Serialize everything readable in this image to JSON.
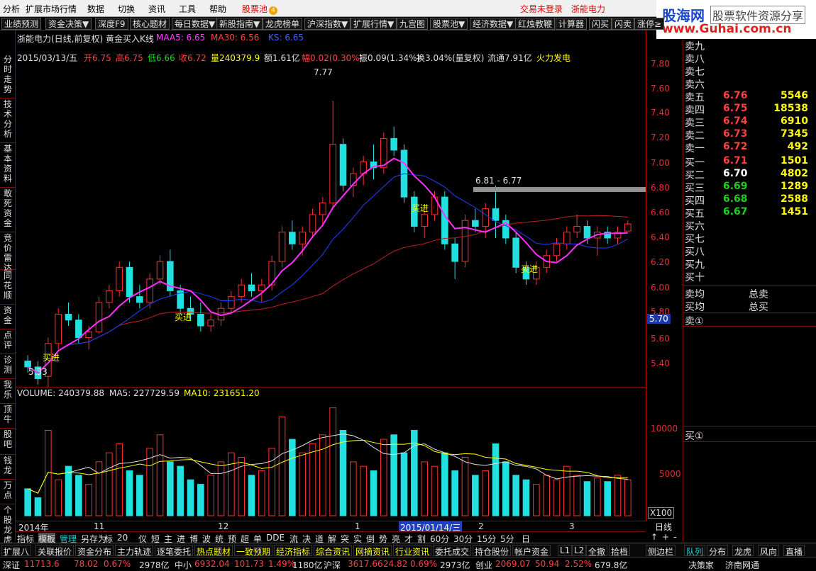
{
  "menu": {
    "items": [
      "分析",
      "扩展市场行情",
      "数据",
      "切换",
      "资讯",
      "工具",
      "帮助"
    ],
    "pool_label": "股票池",
    "pool_badge": "4",
    "login_status": "交易未登录",
    "stock_name": "浙能电力"
  },
  "logo": {
    "brand": "股海网",
    "tagline": "股票软件资源分享",
    "url": "www.Guhai.com.cn"
  },
  "toolbar": [
    "业绩预测",
    "资金决策▼",
    "深度F9",
    "核心题材",
    "每日数据▼",
    "新股指南▼",
    "龙虎榜单",
    "沪深指数▼",
    "扩展行情▼",
    "九宫图",
    "股票池▼",
    "经济数据▼",
    "红烛教鞭",
    "计算器",
    "闪买",
    "闪卖",
    "涨停≥"
  ],
  "left_tabs": [
    "分时走势",
    "技术分析",
    "基本资料",
    "敢死资金",
    "竞价雷达",
    "同花顺",
    "资金",
    "点评",
    "诊测",
    "我乐",
    "顶牛",
    "股吧",
    "钱龙",
    "万点",
    "个股龙虎"
  ],
  "chart": {
    "title": "浙能电力(日线,前复权) 黄金买入K线",
    "ma5_label": "MAA5: 6.65",
    "ma30_label": "MA30: 6.56",
    "ks_label": "KS: 6.65",
    "date": "2015/03/13/五",
    "open": "开6.75",
    "high": "高6.75",
    "low": "低6.66",
    "close": "收6.72",
    "volume_info": "量240379.9",
    "amount": "额1.61亿",
    "change": "幅0.02(0.30%)",
    "amplitude": "振0.09(1.34%)",
    "turnover": "换3.04%(量复权)",
    "float": "流通7.91亿",
    "sector": "火力发电",
    "high_mark": "7.77",
    "low_mark": "5.33",
    "range_label": "6.81 - 6.77",
    "buy_label": "买进",
    "current_price": "5.70",
    "vol_title": "VOLUME: 240379.88",
    "vol_ma5": "MA5: 227729.59",
    "vol_ma10": "MA10: 231651.20",
    "x_labels": [
      "2014年",
      "11",
      "12",
      "1",
      "2015/01/14/三",
      "2",
      "3"
    ],
    "y_labels": [
      "7.80",
      "7.60",
      "7.40",
      "7.20",
      "7.00",
      "6.80",
      "6.60",
      "6.40",
      "6.20",
      "6.00",
      "5.80",
      "5.60",
      "5.40"
    ],
    "vol_y_labels": [
      "10000",
      "5000"
    ],
    "vol_unit": "X100",
    "period": "日线"
  },
  "chart_data": {
    "type": "candlestick",
    "title": "浙能电力(日线,前复权) 黄金买入K线",
    "ylim": [
      5.3,
      7.9
    ],
    "price_ticks": [
      7.8,
      7.6,
      7.4,
      7.2,
      7.0,
      6.8,
      6.6,
      6.4,
      6.2,
      6.0,
      5.8,
      5.6,
      5.4
    ],
    "high": 7.77,
    "low": 5.33,
    "last": {
      "open": 6.75,
      "high": 6.75,
      "low": 6.66,
      "close": 6.72,
      "volume": 240379.88
    },
    "indicators": {
      "MAA5": 6.65,
      "MA30": 6.56,
      "KS": 6.65
    },
    "volume": {
      "MA5": 227729.59,
      "MA10": 231651.2,
      "ticks": [
        10000,
        5000
      ],
      "unit": "X100"
    },
    "series": [
      {
        "name": "MAA5",
        "color": "#ff30ff"
      },
      {
        "name": "MA30",
        "color": "#c02020"
      },
      {
        "name": "KS",
        "color": "#2040ff"
      }
    ],
    "ohlc": [
      [
        5.55,
        5.6,
        5.45,
        5.5
      ],
      [
        5.5,
        5.55,
        5.35,
        5.4
      ],
      [
        5.42,
        5.75,
        5.33,
        5.7
      ],
      [
        5.7,
        6.0,
        5.65,
        5.95
      ],
      [
        5.95,
        6.05,
        5.85,
        5.9
      ],
      [
        5.9,
        5.95,
        5.7,
        5.75
      ],
      [
        5.75,
        5.85,
        5.65,
        5.8
      ],
      [
        5.8,
        6.1,
        5.78,
        6.05
      ],
      [
        6.05,
        6.2,
        6.0,
        6.15
      ],
      [
        6.15,
        6.4,
        6.1,
        6.35
      ],
      [
        6.35,
        6.4,
        6.05,
        6.1
      ],
      [
        6.1,
        6.2,
        6.0,
        6.05
      ],
      [
        6.05,
        6.3,
        6.0,
        6.25
      ],
      [
        6.25,
        6.45,
        6.2,
        6.4
      ],
      [
        6.4,
        6.5,
        6.1,
        6.15
      ],
      [
        6.15,
        6.2,
        5.95,
        6.0
      ],
      [
        6.0,
        6.1,
        5.9,
        5.95
      ],
      [
        5.95,
        6.05,
        5.8,
        5.85
      ],
      [
        5.85,
        5.95,
        5.8,
        5.9
      ],
      [
        5.9,
        6.05,
        5.85,
        6.0
      ],
      [
        6.0,
        6.15,
        5.95,
        6.1
      ],
      [
        6.1,
        6.25,
        6.05,
        6.2
      ],
      [
        6.2,
        6.3,
        6.1,
        6.15
      ],
      [
        6.15,
        6.25,
        6.05,
        6.2
      ],
      [
        6.2,
        6.45,
        6.15,
        6.4
      ],
      [
        6.4,
        6.7,
        6.35,
        6.65
      ],
      [
        6.65,
        6.75,
        6.5,
        6.55
      ],
      [
        6.55,
        6.7,
        6.45,
        6.65
      ],
      [
        6.65,
        6.85,
        6.6,
        6.8
      ],
      [
        6.8,
        6.95,
        6.7,
        6.9
      ],
      [
        6.9,
        7.77,
        6.85,
        7.4
      ],
      [
        7.4,
        7.45,
        7.0,
        7.05
      ],
      [
        7.05,
        7.2,
        6.95,
        7.15
      ],
      [
        7.15,
        7.3,
        7.05,
        7.25
      ],
      [
        7.25,
        7.4,
        7.1,
        7.2
      ],
      [
        7.2,
        7.5,
        7.15,
        7.45
      ],
      [
        7.45,
        7.55,
        7.3,
        7.35
      ],
      [
        7.35,
        7.4,
        6.9,
        6.95
      ],
      [
        6.95,
        7.0,
        6.65,
        6.7
      ],
      [
        6.7,
        6.85,
        6.6,
        6.8
      ],
      [
        6.8,
        7.0,
        6.75,
        6.95
      ],
      [
        6.95,
        7.0,
        6.5,
        6.55
      ],
      [
        6.55,
        6.6,
        6.25,
        6.4
      ],
      [
        6.4,
        6.8,
        6.35,
        6.75
      ],
      [
        6.75,
        6.85,
        6.65,
        6.7
      ],
      [
        6.7,
        6.9,
        6.6,
        6.85
      ],
      [
        6.85,
        7.05,
        6.6,
        6.75
      ],
      [
        6.75,
        6.8,
        6.55,
        6.6
      ],
      [
        6.6,
        6.65,
        6.3,
        6.35
      ],
      [
        6.35,
        6.4,
        6.2,
        6.25
      ],
      [
        6.25,
        6.4,
        6.2,
        6.35
      ],
      [
        6.35,
        6.5,
        6.3,
        6.45
      ],
      [
        6.45,
        6.6,
        6.4,
        6.55
      ],
      [
        6.55,
        6.7,
        6.5,
        6.65
      ],
      [
        6.65,
        6.8,
        6.6,
        6.7
      ],
      [
        6.7,
        6.75,
        6.55,
        6.6
      ],
      [
        6.6,
        6.7,
        6.45,
        6.65
      ],
      [
        6.65,
        6.7,
        6.55,
        6.6
      ],
      [
        6.6,
        6.7,
        6.55,
        6.65
      ],
      [
        6.66,
        6.75,
        6.66,
        6.72
      ]
    ],
    "vol": [
      30,
      20,
      95,
      40,
      55,
      45,
      35,
      60,
      70,
      80,
      50,
      45,
      75,
      90,
      60,
      55,
      40,
      35,
      45,
      60,
      70,
      65,
      45,
      50,
      75,
      110,
      85,
      70,
      80,
      90,
      120,
      95,
      60,
      55,
      50,
      85,
      90,
      70,
      95,
      60,
      55,
      70,
      50,
      65,
      45,
      50,
      80,
      60,
      45,
      40,
      35,
      45,
      40,
      55,
      45,
      38,
      42,
      38,
      45,
      40
    ]
  },
  "order_book": {
    "asks": [
      {
        "label": "卖九",
        "price": "",
        "vol": ""
      },
      {
        "label": "卖八",
        "price": "",
        "vol": ""
      },
      {
        "label": "卖七",
        "price": "",
        "vol": ""
      },
      {
        "label": "卖六",
        "price": "",
        "vol": ""
      },
      {
        "label": "卖五",
        "price": "6.76",
        "vol": "5546",
        "color": "#ff4040"
      },
      {
        "label": "卖四",
        "price": "6.75",
        "vol": "18538",
        "color": "#ff4040"
      },
      {
        "label": "卖三",
        "price": "6.74",
        "vol": "6910",
        "color": "#ff4040"
      },
      {
        "label": "卖二",
        "price": "6.73",
        "vol": "7345",
        "color": "#ff4040"
      },
      {
        "label": "卖一",
        "price": "6.72",
        "vol": "492",
        "color": "#ff4040"
      }
    ],
    "bids": [
      {
        "label": "买一",
        "price": "6.71",
        "vol": "1501",
        "color": "#ff4040"
      },
      {
        "label": "买二",
        "price": "6.70",
        "vol": "4802",
        "color": "#ffffff"
      },
      {
        "label": "买三",
        "price": "6.69",
        "vol": "1289",
        "color": "#20d020"
      },
      {
        "label": "买四",
        "price": "6.68",
        "vol": "2588",
        "color": "#20d020"
      },
      {
        "label": "买五",
        "price": "6.67",
        "vol": "1451",
        "color": "#20d020"
      },
      {
        "label": "买六",
        "price": "",
        "vol": ""
      },
      {
        "label": "买七",
        "price": "",
        "vol": ""
      },
      {
        "label": "买八",
        "price": "",
        "vol": ""
      },
      {
        "label": "买九",
        "price": "",
        "vol": ""
      },
      {
        "label": "买十",
        "price": "",
        "vol": ""
      }
    ],
    "avg_sell": "卖均",
    "total_sell": "总卖",
    "avg_buy": "买均",
    "total_buy": "总买",
    "sell_queue": "卖①",
    "buy_queue": "买①"
  },
  "tabs1": [
    "指标",
    "模板",
    "管理",
    "另存为",
    "标",
    "20",
    "仪",
    "短",
    "主",
    "进",
    "博",
    "波",
    "统",
    "预",
    "超",
    "单",
    "DDE",
    "流",
    "决",
    "道",
    "解",
    "突",
    "实",
    "倒",
    "势",
    "亮",
    "才",
    "割",
    "60分",
    "30分",
    "15分",
    "5分",
    "日"
  ],
  "tabs2": [
    "扩展八",
    "关联报价",
    "资金分布",
    "主力轨迹",
    "逐笔委托",
    "热点题材",
    "一致预期",
    "经济指标",
    "综合资讯",
    "网摘资讯",
    "行业资讯",
    "委托成交",
    "持仓股份",
    "帐户资金",
    "L1",
    "L2",
    "全撤",
    "拾档",
    "侧边栏",
    "队列",
    "分布",
    "龙虎",
    "风向",
    "直播"
  ],
  "ticker": {
    "sh_label": "深证",
    "sh_value": "11713.6",
    "sh_change": "78.02",
    "sh_pct": "0.67%",
    "sh_amount": "2978亿",
    "zx_label": "中小",
    "zx_value": "6932.04",
    "zx_change": "101.73",
    "zx_pct": "1.49%",
    "zx_amount": "1180亿",
    "hs_label": "沪深",
    "hs_value": "3617.66",
    "hs_change": "24.82",
    "hs_pct": "0.69%",
    "hs_amount": "2973亿",
    "cy_label": "创业",
    "cy_value": "2069.07",
    "cy_change": "50.94",
    "cy_pct": "2.52%",
    "cy_amount": "679.8亿",
    "right1": "决策家",
    "right2": "济南网通"
  }
}
